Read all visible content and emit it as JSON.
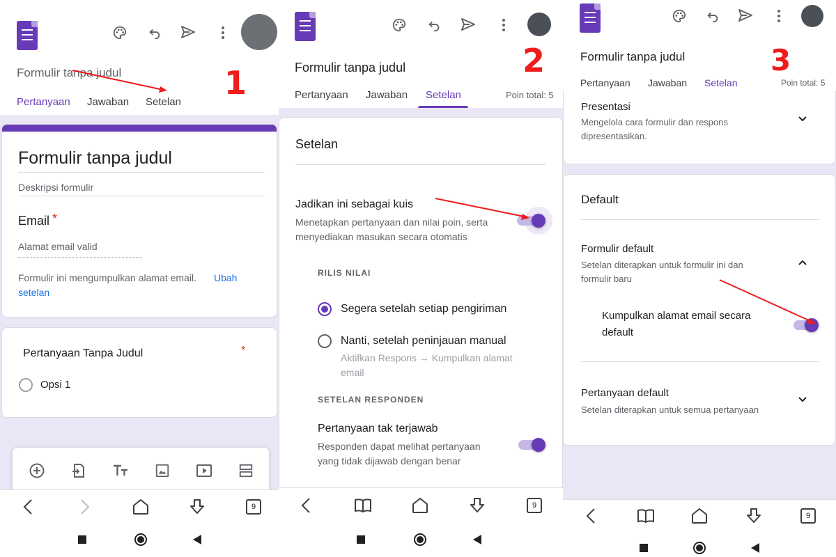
{
  "common": {
    "form_title": "Formulir tanpa judul",
    "tabs": [
      "Pertanyaan",
      "Jawaban",
      "Setelan"
    ],
    "points_total": "Poin total: 5",
    "tab_count": "9"
  },
  "panel1": {
    "step_number": "1",
    "form_card": {
      "title": "Formulir tanpa judul",
      "description_placeholder": "Deskripsi formulir",
      "email_label": "Email",
      "required_mark": "*",
      "email_placeholder": "Alamat email valid",
      "collect_note": "Formulir ini mengumpulkan alamat email.",
      "collect_link_1": "Ubah",
      "collect_link_2": "setelan"
    },
    "question_card": {
      "title": "Pertanyaan Tanpa Judul",
      "required_mark": "*",
      "option": "Opsi 1"
    }
  },
  "panel2": {
    "step_number": "2",
    "settings_title": "Setelan",
    "quiz_title": "Jadikan ini sebagai kuis",
    "quiz_desc_1": "Menetapkan pertanyaan dan nilai poin, serta",
    "quiz_desc_2": "menyediakan masukan secara otomatis",
    "release_heading": "RILIS NILAI",
    "release_opt1": "Segera setelah setiap pengiriman",
    "release_opt2": "Nanti, setelah peninjauan manual",
    "release_opt2_note_1": "Aktifkan Respons → Kumpulkan alamat",
    "release_opt2_note_2": "email",
    "respondent_heading": "SETELAN RESPONDEN",
    "missed_title": "Pertanyaan tak terjawab",
    "missed_desc_1": "Responden dapat melihat pertanyaan",
    "missed_desc_2": "yang tidak dijawab dengan benar"
  },
  "panel3": {
    "step_number": "3",
    "presentation_title": "Presentasi",
    "presentation_desc_1": "Mengelola cara formulir dan respons",
    "presentation_desc_2": "dipresentasikan.",
    "default_title": "Default",
    "form_default_title": "Formulir default",
    "form_default_desc_1": "Setelan diterapkan untuk formulir ini dan",
    "form_default_desc_2": "formulir baru",
    "collect_email_1": "Kumpulkan alamat email secara",
    "collect_email_2": "default",
    "question_default_title": "Pertanyaan default",
    "question_default_desc": "Setelan diterapkan untuk semua pertanyaan"
  },
  "icons": {
    "toolbar": [
      "palette-icon",
      "undo-icon",
      "send-icon",
      "more-vert-icon"
    ],
    "question_tools": [
      "add-question-icon",
      "import-questions-icon",
      "add-title-icon",
      "add-image-icon",
      "add-video-icon",
      "add-section-icon"
    ],
    "browser_nav": [
      "back-icon",
      "forward-icon",
      "home-icon",
      "download-icon",
      "tabs-icon"
    ],
    "system_nav": [
      "recents-square-icon",
      "home-circle-icon",
      "back-triangle-icon"
    ]
  },
  "colors": {
    "accent": "#673ab7",
    "annotation_red": "#ee1c1c",
    "background_lavender": "#eae6f6"
  }
}
